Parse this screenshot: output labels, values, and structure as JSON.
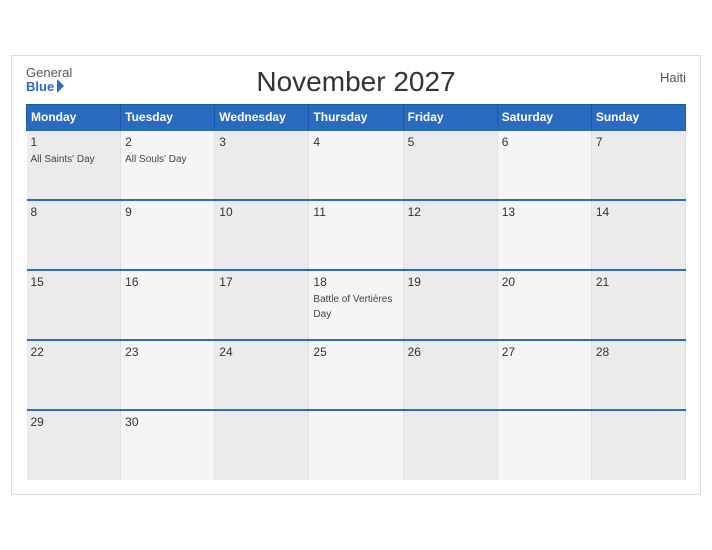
{
  "header": {
    "title": "November 2027",
    "country": "Haiti",
    "logo_general": "General",
    "logo_blue": "Blue"
  },
  "columns": [
    "Monday",
    "Tuesday",
    "Wednesday",
    "Thursday",
    "Friday",
    "Saturday",
    "Sunday"
  ],
  "weeks": [
    [
      {
        "day": "1",
        "holiday": "All Saints' Day"
      },
      {
        "day": "2",
        "holiday": "All Souls' Day"
      },
      {
        "day": "3",
        "holiday": ""
      },
      {
        "day": "4",
        "holiday": ""
      },
      {
        "day": "5",
        "holiday": ""
      },
      {
        "day": "6",
        "holiday": ""
      },
      {
        "day": "7",
        "holiday": ""
      }
    ],
    [
      {
        "day": "8",
        "holiday": ""
      },
      {
        "day": "9",
        "holiday": ""
      },
      {
        "day": "10",
        "holiday": ""
      },
      {
        "day": "11",
        "holiday": ""
      },
      {
        "day": "12",
        "holiday": ""
      },
      {
        "day": "13",
        "holiday": ""
      },
      {
        "day": "14",
        "holiday": ""
      }
    ],
    [
      {
        "day": "15",
        "holiday": ""
      },
      {
        "day": "16",
        "holiday": ""
      },
      {
        "day": "17",
        "holiday": ""
      },
      {
        "day": "18",
        "holiday": "Battle of Vertières Day"
      },
      {
        "day": "19",
        "holiday": ""
      },
      {
        "day": "20",
        "holiday": ""
      },
      {
        "day": "21",
        "holiday": ""
      }
    ],
    [
      {
        "day": "22",
        "holiday": ""
      },
      {
        "day": "23",
        "holiday": ""
      },
      {
        "day": "24",
        "holiday": ""
      },
      {
        "day": "25",
        "holiday": ""
      },
      {
        "day": "26",
        "holiday": ""
      },
      {
        "day": "27",
        "holiday": ""
      },
      {
        "day": "28",
        "holiday": ""
      }
    ],
    [
      {
        "day": "29",
        "holiday": ""
      },
      {
        "day": "30",
        "holiday": ""
      },
      {
        "day": "",
        "holiday": ""
      },
      {
        "day": "",
        "holiday": ""
      },
      {
        "day": "",
        "holiday": ""
      },
      {
        "day": "",
        "holiday": ""
      },
      {
        "day": "",
        "holiday": ""
      }
    ]
  ]
}
